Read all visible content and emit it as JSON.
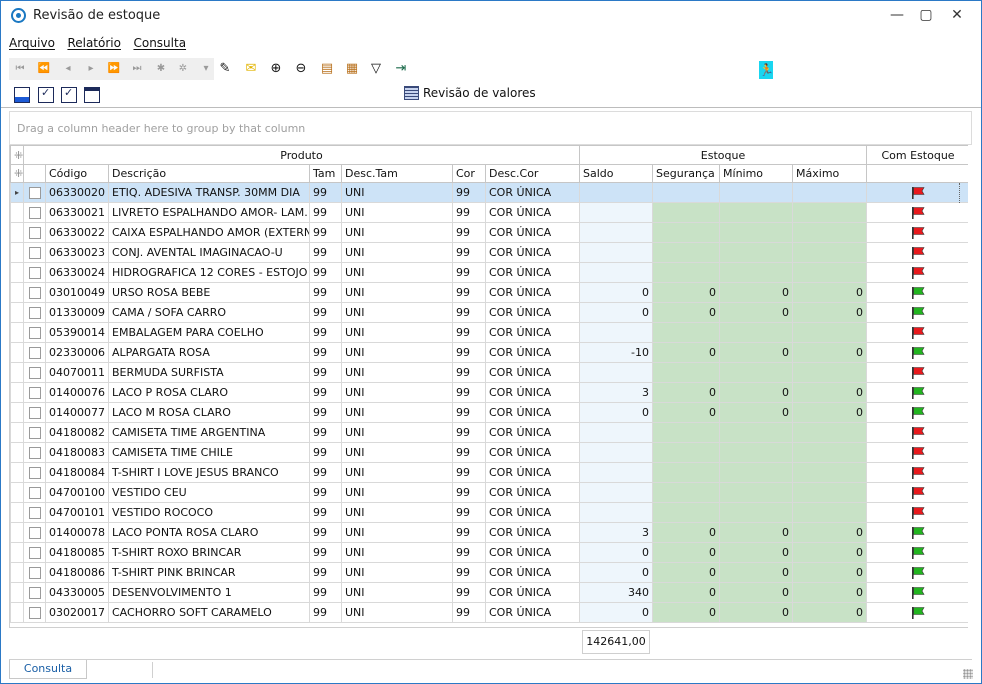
{
  "window": {
    "title": "Revisão de estoque"
  },
  "menu": [
    "Arquivo",
    "Relatório",
    "Consulta"
  ],
  "toolbar": {
    "revision_button": "Revisão de valores"
  },
  "group_panel": {
    "placeholder": "Drag a column header here to group by that column"
  },
  "bands": {
    "produto": "Produto",
    "estoque": "Estoque",
    "com_estoque": "Com Estoque"
  },
  "columns": [
    "Código",
    "Descrição",
    "Tam",
    "Desc.Tam",
    "Cor",
    "Desc.Cor",
    "Saldo",
    "Segurança",
    "Mínimo",
    "Máximo"
  ],
  "rows": [
    {
      "codigo": "06330020",
      "descricao": "ETIQ. ADESIVA TRANSP. 30MM DIA",
      "tam": "99",
      "desc_tam": "UNI",
      "cor": "99",
      "desc_cor": "COR ÚNICA",
      "saldo": "",
      "seguranca": "",
      "minimo": "",
      "maximo": "",
      "flag": "red"
    },
    {
      "codigo": "06330021",
      "descricao": "LIVRETO ESPALHANDO AMOR- LAM.",
      "tam": "99",
      "desc_tam": "UNI",
      "cor": "99",
      "desc_cor": "COR ÚNICA",
      "saldo": "",
      "seguranca": "",
      "minimo": "",
      "maximo": "",
      "flag": "red"
    },
    {
      "codigo": "06330022",
      "descricao": "CAIXA ESPALHANDO AMOR (EXTERNA",
      "tam": "99",
      "desc_tam": "UNI",
      "cor": "99",
      "desc_cor": "COR ÚNICA",
      "saldo": "",
      "seguranca": "",
      "minimo": "",
      "maximo": "",
      "flag": "red"
    },
    {
      "codigo": "06330023",
      "descricao": "CONJ. AVENTAL IMAGINACAO-U",
      "tam": "99",
      "desc_tam": "UNI",
      "cor": "99",
      "desc_cor": "COR ÚNICA",
      "saldo": "",
      "seguranca": "",
      "minimo": "",
      "maximo": "",
      "flag": "red"
    },
    {
      "codigo": "06330024",
      "descricao": "HIDROGRAFICA 12 CORES - ESTOJO",
      "tam": "99",
      "desc_tam": "UNI",
      "cor": "99",
      "desc_cor": "COR ÚNICA",
      "saldo": "",
      "seguranca": "",
      "minimo": "",
      "maximo": "",
      "flag": "red"
    },
    {
      "codigo": "03010049",
      "descricao": "URSO ROSA BEBE",
      "tam": "99",
      "desc_tam": "UNI",
      "cor": "99",
      "desc_cor": "COR ÚNICA",
      "saldo": "0",
      "seguranca": "0",
      "minimo": "0",
      "maximo": "0",
      "flag": "green"
    },
    {
      "codigo": "01330009",
      "descricao": "CAMA / SOFA CARRO",
      "tam": "99",
      "desc_tam": "UNI",
      "cor": "99",
      "desc_cor": "COR ÚNICA",
      "saldo": "0",
      "seguranca": "0",
      "minimo": "0",
      "maximo": "0",
      "flag": "green"
    },
    {
      "codigo": "05390014",
      "descricao": "EMBALAGEM PARA COELHO",
      "tam": "99",
      "desc_tam": "UNI",
      "cor": "99",
      "desc_cor": "COR ÚNICA",
      "saldo": "",
      "seguranca": "",
      "minimo": "",
      "maximo": "",
      "flag": "red"
    },
    {
      "codigo": "02330006",
      "descricao": "ALPARGATA ROSA",
      "tam": "99",
      "desc_tam": "UNI",
      "cor": "99",
      "desc_cor": "COR ÚNICA",
      "saldo": "-10",
      "seguranca": "0",
      "minimo": "0",
      "maximo": "0",
      "flag": "green"
    },
    {
      "codigo": "04070011",
      "descricao": "BERMUDA SURFISTA",
      "tam": "99",
      "desc_tam": "UNI",
      "cor": "99",
      "desc_cor": "COR ÚNICA",
      "saldo": "",
      "seguranca": "",
      "minimo": "",
      "maximo": "",
      "flag": "red"
    },
    {
      "codigo": "01400076",
      "descricao": "LACO P ROSA CLARO",
      "tam": "99",
      "desc_tam": "UNI",
      "cor": "99",
      "desc_cor": "COR ÚNICA",
      "saldo": "3",
      "seguranca": "0",
      "minimo": "0",
      "maximo": "0",
      "flag": "green"
    },
    {
      "codigo": "01400077",
      "descricao": "LACO M ROSA CLARO",
      "tam": "99",
      "desc_tam": "UNI",
      "cor": "99",
      "desc_cor": "COR ÚNICA",
      "saldo": "0",
      "seguranca": "0",
      "minimo": "0",
      "maximo": "0",
      "flag": "green"
    },
    {
      "codigo": "04180082",
      "descricao": "CAMISETA TIME ARGENTINA",
      "tam": "99",
      "desc_tam": "UNI",
      "cor": "99",
      "desc_cor": "COR ÚNICA",
      "saldo": "",
      "seguranca": "",
      "minimo": "",
      "maximo": "",
      "flag": "red"
    },
    {
      "codigo": "04180083",
      "descricao": "CAMISETA TIME CHILE",
      "tam": "99",
      "desc_tam": "UNI",
      "cor": "99",
      "desc_cor": "COR ÚNICA",
      "saldo": "",
      "seguranca": "",
      "minimo": "",
      "maximo": "",
      "flag": "red"
    },
    {
      "codigo": "04180084",
      "descricao": "T-SHIRT I LOVE JESUS BRANCO",
      "tam": "99",
      "desc_tam": "UNI",
      "cor": "99",
      "desc_cor": "COR ÚNICA",
      "saldo": "",
      "seguranca": "",
      "minimo": "",
      "maximo": "",
      "flag": "red"
    },
    {
      "codigo": "04700100",
      "descricao": "VESTIDO CEU",
      "tam": "99",
      "desc_tam": "UNI",
      "cor": "99",
      "desc_cor": "COR ÚNICA",
      "saldo": "",
      "seguranca": "",
      "minimo": "",
      "maximo": "",
      "flag": "red"
    },
    {
      "codigo": "04700101",
      "descricao": "VESTIDO ROCOCO",
      "tam": "99",
      "desc_tam": "UNI",
      "cor": "99",
      "desc_cor": "COR ÚNICA",
      "saldo": "",
      "seguranca": "",
      "minimo": "",
      "maximo": "",
      "flag": "red"
    },
    {
      "codigo": "01400078",
      "descricao": "LACO PONTA ROSA CLARO",
      "tam": "99",
      "desc_tam": "UNI",
      "cor": "99",
      "desc_cor": "COR ÚNICA",
      "saldo": "3",
      "seguranca": "0",
      "minimo": "0",
      "maximo": "0",
      "flag": "green"
    },
    {
      "codigo": "04180085",
      "descricao": "T-SHIRT ROXO BRINCAR",
      "tam": "99",
      "desc_tam": "UNI",
      "cor": "99",
      "desc_cor": "COR ÚNICA",
      "saldo": "0",
      "seguranca": "0",
      "minimo": "0",
      "maximo": "0",
      "flag": "green"
    },
    {
      "codigo": "04180086",
      "descricao": "T-SHIRT PINK BRINCAR",
      "tam": "99",
      "desc_tam": "UNI",
      "cor": "99",
      "desc_cor": "COR ÚNICA",
      "saldo": "0",
      "seguranca": "0",
      "minimo": "0",
      "maximo": "0",
      "flag": "green"
    },
    {
      "codigo": "04330005",
      "descricao": "DESENVOLVIMENTO 1",
      "tam": "99",
      "desc_tam": "UNI",
      "cor": "99",
      "desc_cor": "COR ÚNICA",
      "saldo": "340",
      "seguranca": "0",
      "minimo": "0",
      "maximo": "0",
      "flag": "green"
    },
    {
      "codigo": "03020017",
      "descricao": "CACHORRO SOFT CARAMELO",
      "tam": "99",
      "desc_tam": "UNI",
      "cor": "99",
      "desc_cor": "COR ÚNICA",
      "saldo": "0",
      "seguranca": "0",
      "minimo": "0",
      "maximo": "0",
      "flag": "green"
    }
  ],
  "footer": {
    "total_saldo": "142641,00"
  },
  "bottom_tabs": [
    "Consulta"
  ],
  "colors": {
    "selected_row": "#cde3f7",
    "saldo_bg": "#eef6fc",
    "stock_bg": "#c8e2c6",
    "flag_red": "#e8191d",
    "flag_green": "#22b41f",
    "window_border": "#2b79c6"
  }
}
